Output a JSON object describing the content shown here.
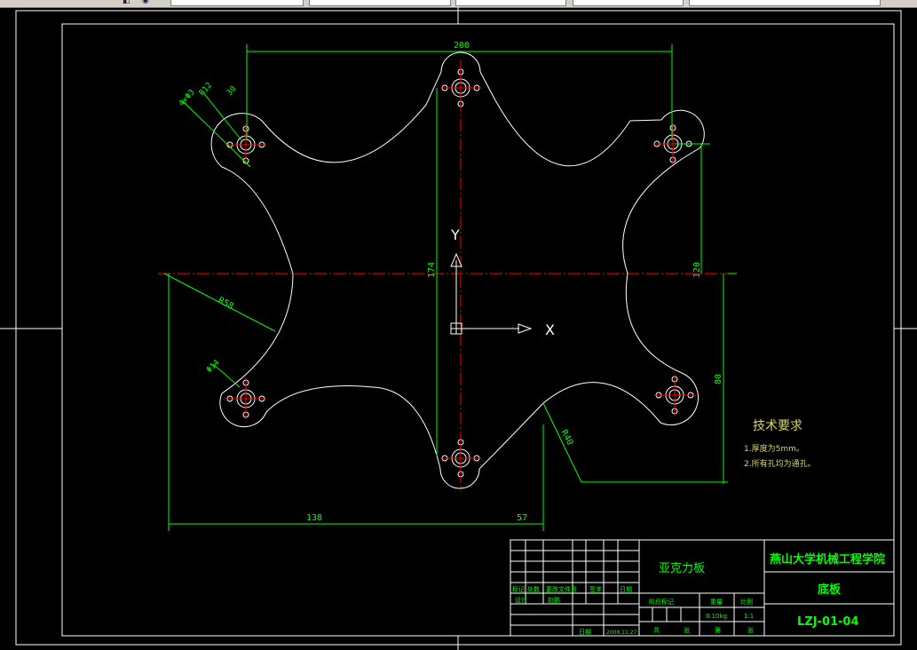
{
  "toolbar": {
    "icons": [
      "layer-icon",
      "palette-icon"
    ],
    "fields": [
      "",
      "",
      "",
      "",
      ""
    ]
  },
  "axes": {
    "y_label": "Y",
    "x_label": "X"
  },
  "dims": {
    "top_width": "200",
    "hole_spec": "4×Φ3",
    "hole_r": "R12",
    "hole_offset": "30",
    "large_r": "R58",
    "pin_dia": "Φ14",
    "height_174": "174",
    "height_120": "120",
    "height_80": "80",
    "r_bottom": "R40",
    "left_138": "138",
    "right_57": "57"
  },
  "notes": {
    "title": "技术要求",
    "line1": "1.厚度为5mm。",
    "line2": "2.所有孔均为通孔。"
  },
  "title_block": {
    "material": "亚克力板",
    "school": "燕山大学机械工程学院",
    "part_name": "底板",
    "drawing_no": "LZJ-01-04",
    "row_headers": [
      "标记",
      "处数",
      "更改文件号",
      "签字",
      "日期"
    ],
    "designer_label": "设计",
    "designer_name": "赵鹏",
    "date_label": "日期",
    "date_value": "2008.11.27",
    "stage_header": "阶段标记",
    "weight_header": "重量",
    "scale_header": "比例",
    "weight": "0.10kg",
    "scale": "1:1",
    "total_label": "共",
    "sheet_label": "张",
    "sheet_no_label": "第",
    "sheet_label2": "张"
  },
  "colors": {
    "background": "#000000",
    "outline": "#ffffff",
    "dimension": "#00ff00",
    "centerline": "#ff0000"
  }
}
